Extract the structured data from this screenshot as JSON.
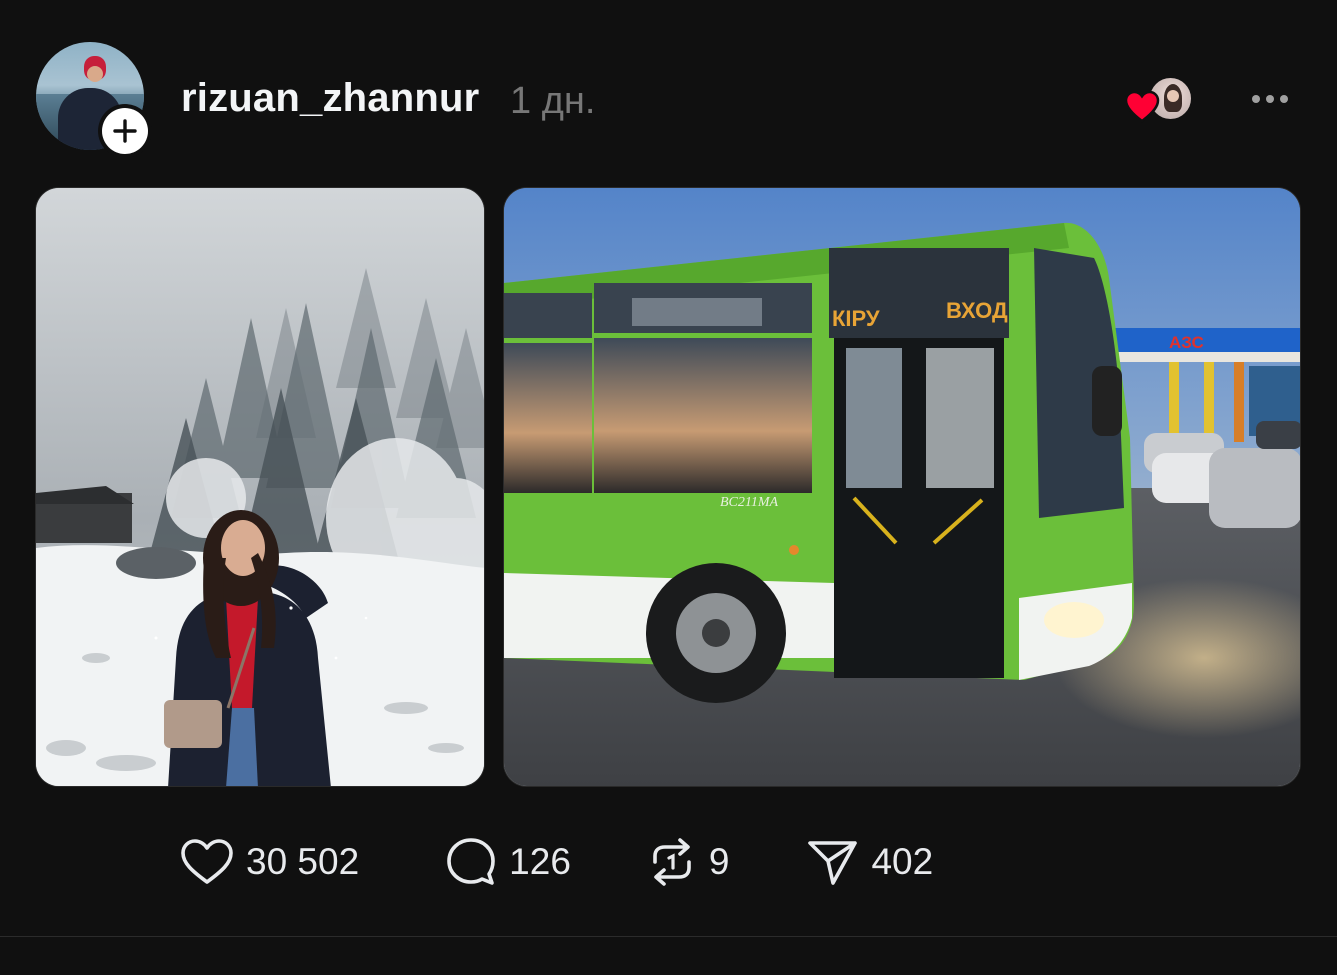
{
  "post": {
    "author": {
      "username": "rizuan_zhannur",
      "time": "1 дн."
    },
    "images": [
      {
        "alt": ""
      },
      {
        "alt": ""
      }
    ],
    "bus_signs": {
      "entry_kz": "КІРУ",
      "entry_ru": "ВХОД",
      "gas_station": "АЗС",
      "bus_number": "BC211MA"
    },
    "actions": {
      "likes": "30 502",
      "comments": "126",
      "reposts": "9",
      "shares": "402"
    }
  },
  "colors": {
    "background": "#101010",
    "text": "#f3f5f7",
    "muted": "#777777",
    "heart": "#ff0034"
  },
  "icons": {
    "follow": "plus-icon",
    "liked_by": "heart-icon",
    "more": "more-horizontal-icon",
    "like": "heart-outline-icon",
    "comment": "comment-bubble-icon",
    "repost": "repost-icon",
    "share": "send-icon"
  }
}
